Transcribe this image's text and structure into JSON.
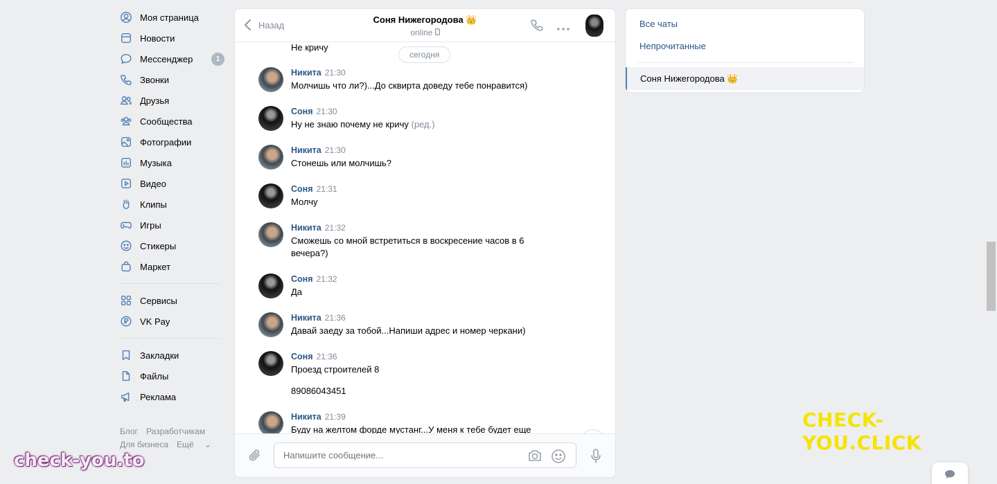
{
  "left_nav": {
    "items": [
      {
        "label": "Моя страница",
        "icon": "user-circle-icon"
      },
      {
        "label": "Новости",
        "icon": "news-icon"
      },
      {
        "label": "Мессенджер",
        "icon": "message-icon",
        "badge": "1"
      },
      {
        "label": "Звонки",
        "icon": "phone-icon"
      },
      {
        "label": "Друзья",
        "icon": "friends-icon"
      },
      {
        "label": "Сообщества",
        "icon": "communities-icon"
      },
      {
        "label": "Фотографии",
        "icon": "photos-icon"
      },
      {
        "label": "Музыка",
        "icon": "music-icon"
      },
      {
        "label": "Видео",
        "icon": "video-icon"
      },
      {
        "label": "Клипы",
        "icon": "clips-icon"
      },
      {
        "label": "Игры",
        "icon": "games-icon"
      },
      {
        "label": "Стикеры",
        "icon": "stickers-icon"
      },
      {
        "label": "Маркет",
        "icon": "market-icon"
      },
      {
        "label": "Сервисы",
        "icon": "services-icon"
      },
      {
        "label": "VK Pay",
        "icon": "vkpay-icon"
      },
      {
        "label": "Закладки",
        "icon": "bookmark-icon"
      },
      {
        "label": "Файлы",
        "icon": "files-icon"
      },
      {
        "label": "Реклама",
        "icon": "ads-icon"
      }
    ],
    "footer": [
      "Блог",
      "Разработчикам",
      "Для бизнеса",
      "Ещё"
    ]
  },
  "chat": {
    "back_label": "Назад",
    "title": "Соня Нижегородова 👑",
    "status": "online",
    "top_partial": "Не кричу",
    "date_pill": "сегодня",
    "messages": [
      {
        "author": "Никита",
        "time": "21:30",
        "lines": [
          "Молчишь что ли?)...До сквирта доведу тебе понравится)"
        ]
      },
      {
        "author": "Соня",
        "time": "21:30",
        "lines": [
          "Ну не знаю почему не кричу"
        ],
        "edited": "(ред.)"
      },
      {
        "author": "Никита",
        "time": "21:30",
        "lines": [
          "Стонешь или молчишь?"
        ]
      },
      {
        "author": "Соня",
        "time": "21:31",
        "lines": [
          "Молчу"
        ]
      },
      {
        "author": "Никита",
        "time": "21:32",
        "lines": [
          "Сможешь со мной встретиться в воскресение часов в 6 вечера?)"
        ]
      },
      {
        "author": "Соня",
        "time": "21:32",
        "lines": [
          "Да"
        ]
      },
      {
        "author": "Никита",
        "time": "21:36",
        "lines": [
          "Давай заеду за тобой...Напиши адрес и номер черкани)"
        ]
      },
      {
        "author": "Соня",
        "time": "21:36",
        "lines": [
          "Проезд строителей 8",
          "89086043451"
        ]
      },
      {
        "author": "Никита",
        "time": "21:39",
        "lines": [
          "Буду на желтом форде мустанг...У меня к тебе будет еще"
        ]
      }
    ],
    "input_placeholder": "Напишите сообщение..."
  },
  "right_panel": {
    "all_chats": "Все чаты",
    "unread": "Непрочитанные",
    "active_chat": "Соня Нижегородова 👑"
  },
  "watermarks": {
    "right": "CHECK-YOU.CLICK",
    "left": "check-you.to"
  },
  "colors": {
    "accent": "#2a5885",
    "page_bg": "#edeef0",
    "watermark_yellow": "#f5e400"
  }
}
